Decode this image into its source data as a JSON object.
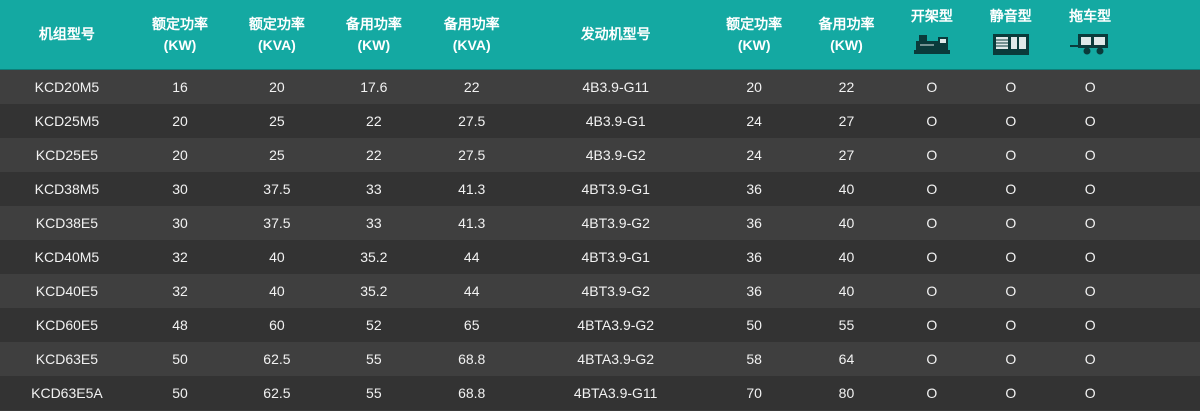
{
  "header": {
    "model": "机组型号",
    "rated_kw": {
      "title": "额定功率",
      "unit": "(KW)"
    },
    "rated_kva": {
      "title": "额定功率",
      "unit": "(KVA)"
    },
    "standby_kw": {
      "title": "备用功率",
      "unit": "(KW)"
    },
    "standby_kva": {
      "title": "备用功率",
      "unit": "(KVA)"
    },
    "engine_model": "发动机型号",
    "engine_rated_kw": {
      "title": "额定功率",
      "unit": "(KW)"
    },
    "engine_standby_kw": {
      "title": "备用功率",
      "unit": "(KW)"
    },
    "open_type": {
      "title": "开架型",
      "icon": "open-frame-genset-icon"
    },
    "silent_type": {
      "title": "静音型",
      "icon": "silent-genset-icon"
    },
    "trailer_type": {
      "title": "拖车型",
      "icon": "trailer-genset-icon"
    }
  },
  "colors": {
    "header_bg": "#14a9a2",
    "row_odd": "#3f3f3f",
    "row_even": "#333333",
    "text": "#f2f2f2"
  },
  "rows": [
    [
      "KCD20M5",
      "16",
      "20",
      "17.6",
      "22",
      "4B3.9-G11",
      "20",
      "22",
      "O",
      "O",
      "O"
    ],
    [
      "KCD25M5",
      "20",
      "25",
      "22",
      "27.5",
      "4B3.9-G1",
      "24",
      "27",
      "O",
      "O",
      "O"
    ],
    [
      "KCD25E5",
      "20",
      "25",
      "22",
      "27.5",
      "4B3.9-G2",
      "24",
      "27",
      "O",
      "O",
      "O"
    ],
    [
      "KCD38M5",
      "30",
      "37.5",
      "33",
      "41.3",
      "4BT3.9-G1",
      "36",
      "40",
      "O",
      "O",
      "O"
    ],
    [
      "KCD38E5",
      "30",
      "37.5",
      "33",
      "41.3",
      "4BT3.9-G2",
      "36",
      "40",
      "O",
      "O",
      "O"
    ],
    [
      "KCD40M5",
      "32",
      "40",
      "35.2",
      "44",
      "4BT3.9-G1",
      "36",
      "40",
      "O",
      "O",
      "O"
    ],
    [
      "KCD40E5",
      "32",
      "40",
      "35.2",
      "44",
      "4BT3.9-G2",
      "36",
      "40",
      "O",
      "O",
      "O"
    ],
    [
      "KCD60E5",
      "48",
      "60",
      "52",
      "65",
      "4BTA3.9-G2",
      "50",
      "55",
      "O",
      "O",
      "O"
    ],
    [
      "KCD63E5",
      "50",
      "62.5",
      "55",
      "68.8",
      "4BTA3.9-G2",
      "58",
      "64",
      "O",
      "O",
      "O"
    ],
    [
      "KCD63E5A",
      "50",
      "62.5",
      "55",
      "68.8",
      "4BTA3.9-G11",
      "70",
      "80",
      "O",
      "O",
      "O"
    ]
  ]
}
